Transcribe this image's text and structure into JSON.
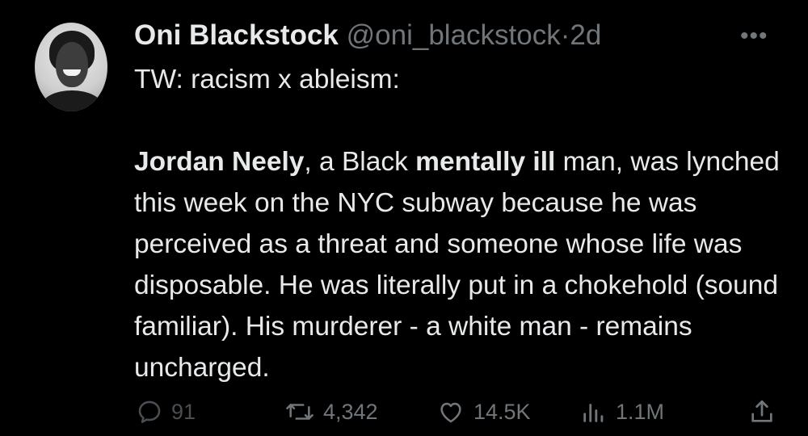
{
  "author": {
    "name": "Oni Blackstock",
    "handle": "@oni_blackstock",
    "separator": "·",
    "time": "2d"
  },
  "more_icon": "more-horizontal-icon",
  "content": {
    "line1": "TW: racism x ableism:",
    "p2_bold1": "Jordan Neely",
    "p2_text1": ", a Black ",
    "p2_bold2": "mentally ill",
    "p2_text2": " man, was lynched this week on the NYC subway because he was perceived as a threat and someone whose life was disposable. He was literally put in a chokehold (sound familiar). His murderer - a white man - remains uncharged."
  },
  "actions": {
    "replies": "91",
    "retweets": "4,342",
    "likes": "14.5K",
    "views": "1.1M"
  },
  "icons": {
    "reply": "reply-icon",
    "retweet": "retweet-icon",
    "like": "heart-icon",
    "views": "views-icon",
    "share": "share-icon"
  },
  "colors": {
    "background": "#000000",
    "text": "#e7e9ea",
    "muted": "#71767b"
  }
}
